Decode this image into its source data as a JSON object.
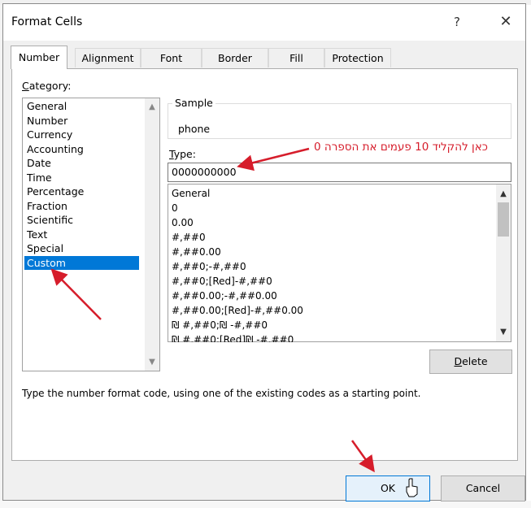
{
  "dialog": {
    "title": "Format Cells",
    "help_label": "?",
    "close_label": "✕"
  },
  "tabs": [
    {
      "label": "Number",
      "active": true
    },
    {
      "label": "Alignment",
      "active": false
    },
    {
      "label": "Font",
      "active": false
    },
    {
      "label": "Border",
      "active": false
    },
    {
      "label": "Fill",
      "active": false
    },
    {
      "label": "Protection",
      "active": false
    }
  ],
  "category": {
    "label_underlined": "C",
    "label_rest": "ategory:",
    "items": [
      "General",
      "Number",
      "Currency",
      "Accounting",
      "Date",
      "Time",
      "Percentage",
      "Fraction",
      "Scientific",
      "Text",
      "Special",
      "Custom"
    ],
    "selected": "Custom"
  },
  "sample": {
    "title": "Sample",
    "value": "phone"
  },
  "type": {
    "label_underlined": "T",
    "label_rest": "ype:",
    "value": "0000000000"
  },
  "formats": [
    "General",
    "0",
    "0.00",
    "#,##0",
    "#,##0.00",
    "#,##0;-#,##0",
    "#,##0;[Red]-#,##0",
    "#,##0.00;-#,##0.00",
    "#,##0.00;[Red]-#,##0.00",
    "₪ #,##0;₪ -#,##0",
    "₪ #,##0;[Red]₪ -#,##0"
  ],
  "delete_button": {
    "underlined": "D",
    "rest": "elete"
  },
  "description": "Type the number format code, using one of the existing codes as a starting point.",
  "annotation": "כאן להקליד 10 פעמים את הספרה 0",
  "ok_label": "OK",
  "cancel_label": "Cancel",
  "colors": {
    "accent": "#0078d7",
    "annotation": "#d61d2b"
  }
}
